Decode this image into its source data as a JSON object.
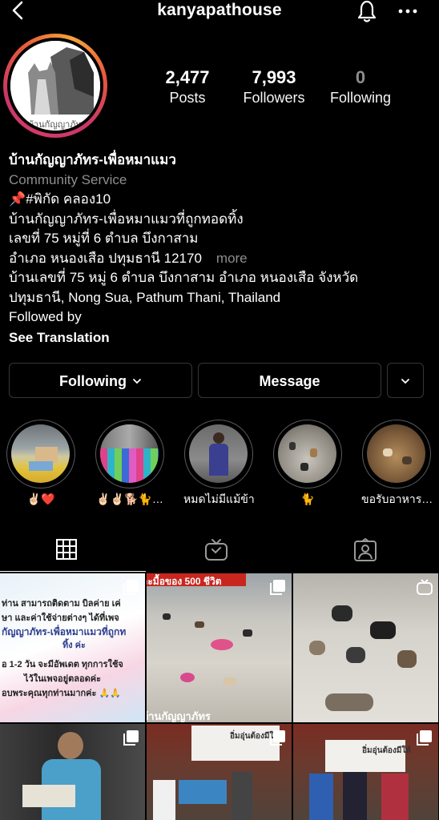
{
  "header": {
    "username": "kanyapathouse",
    "back_icon": "chevron-left-icon",
    "bell_icon": "bell-icon",
    "more_icon": "ellipsis-icon"
  },
  "avatar": {
    "text": "บ้านกัญญาภัทร"
  },
  "stats": [
    {
      "value": "2,477",
      "label": "Posts"
    },
    {
      "value": "7,993",
      "label": "Followers"
    },
    {
      "value": "0",
      "label": "Following"
    }
  ],
  "bio": {
    "name": "บ้านกัญญาภัทร-เพื่อหมาแมว",
    "category": "Community Service",
    "line1": "📌#พิกัด คลอง10",
    "line2": "บ้านกัญญาภัทร-เพื่อหมาแมวที่ถูกทอดทิ้ง",
    "line3": "เลขที่ 75 หมู่ที่ 6 ตำบล บึงกาสาม",
    "line4": "อำเภอ หนองเสือ ปทุมธานี 12170",
    "more": "more",
    "address1": "บ้านเลขที่ 75 หมู่ 6 ตำบล บึงกาสาม อำเภอ หนองเสือ จังหวัด",
    "address2": "ปทุมธานี, Nong Sua, Pathum Thani, Thailand",
    "followed_by": "Followed by",
    "see_translation": "See Translation"
  },
  "buttons": {
    "following": "Following",
    "message": "Message"
  },
  "highlights": [
    {
      "caption": "✌🏻❤️"
    },
    {
      "caption": "✌🏻✌🏻🐕🐈…"
    },
    {
      "caption": "หมดไม่มีแม้ข้าวส"
    },
    {
      "caption": "🐈"
    },
    {
      "caption": "ขอรับอาหาร…"
    }
  ],
  "tabs": [
    "grid-icon",
    "igtv-icon",
    "tagged-icon"
  ],
  "posts": [
    {
      "line1": "ท่าน สามารถติดตาม บิลค่าย เค่",
      "line2": "ษา และค่าใช้จ่ายต่างๆ ได้ที่เพจ",
      "line3": "กัญญาภัทร-เพื่อหมาแมวที่ถูกท",
      "line4": "ทิ้ง ค่ะ",
      "line5": "อ 1-2 วัน จะมีอัพเดต ทุกการใช้จ",
      "line6": "ไว้ในเพจอยู่ตลอดค่ะ",
      "line7": "อบพระคุณทุกท่านมากค่ะ 🙏🙏"
    },
    {
      "top": "ละมื้อของ 500 ชีวิต",
      "bottom": "บ้านกัญญาภัทร"
    },
    {},
    {},
    {
      "banner": "อิ่มอุ่นต้องมีให้"
    },
    {
      "banner": "อิ่มอุ่นต้องมีให้"
    }
  ],
  "colors": {
    "border": "#363636",
    "muted": "#8e8e8e",
    "accent": "#d63a6a"
  }
}
